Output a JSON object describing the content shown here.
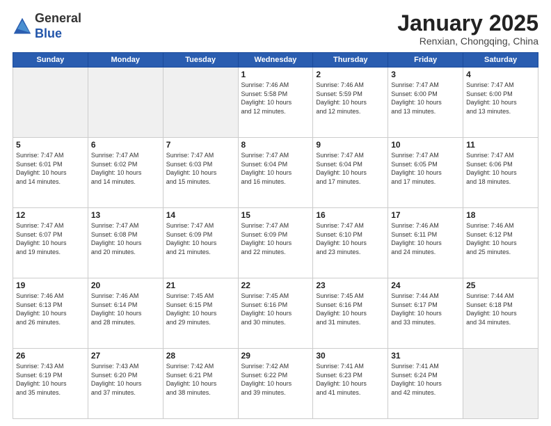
{
  "header": {
    "logo_general": "General",
    "logo_blue": "Blue",
    "month_title": "January 2025",
    "subtitle": "Renxian, Chongqing, China"
  },
  "weekdays": [
    "Sunday",
    "Monday",
    "Tuesday",
    "Wednesday",
    "Thursday",
    "Friday",
    "Saturday"
  ],
  "weeks": [
    [
      {
        "num": "",
        "info": "",
        "empty": true
      },
      {
        "num": "",
        "info": "",
        "empty": true
      },
      {
        "num": "",
        "info": "",
        "empty": true
      },
      {
        "num": "1",
        "info": "Sunrise: 7:46 AM\nSunset: 5:58 PM\nDaylight: 10 hours\nand 12 minutes."
      },
      {
        "num": "2",
        "info": "Sunrise: 7:46 AM\nSunset: 5:59 PM\nDaylight: 10 hours\nand 12 minutes."
      },
      {
        "num": "3",
        "info": "Sunrise: 7:47 AM\nSunset: 6:00 PM\nDaylight: 10 hours\nand 13 minutes."
      },
      {
        "num": "4",
        "info": "Sunrise: 7:47 AM\nSunset: 6:00 PM\nDaylight: 10 hours\nand 13 minutes."
      }
    ],
    [
      {
        "num": "5",
        "info": "Sunrise: 7:47 AM\nSunset: 6:01 PM\nDaylight: 10 hours\nand 14 minutes."
      },
      {
        "num": "6",
        "info": "Sunrise: 7:47 AM\nSunset: 6:02 PM\nDaylight: 10 hours\nand 14 minutes."
      },
      {
        "num": "7",
        "info": "Sunrise: 7:47 AM\nSunset: 6:03 PM\nDaylight: 10 hours\nand 15 minutes."
      },
      {
        "num": "8",
        "info": "Sunrise: 7:47 AM\nSunset: 6:04 PM\nDaylight: 10 hours\nand 16 minutes."
      },
      {
        "num": "9",
        "info": "Sunrise: 7:47 AM\nSunset: 6:04 PM\nDaylight: 10 hours\nand 17 minutes."
      },
      {
        "num": "10",
        "info": "Sunrise: 7:47 AM\nSunset: 6:05 PM\nDaylight: 10 hours\nand 17 minutes."
      },
      {
        "num": "11",
        "info": "Sunrise: 7:47 AM\nSunset: 6:06 PM\nDaylight: 10 hours\nand 18 minutes."
      }
    ],
    [
      {
        "num": "12",
        "info": "Sunrise: 7:47 AM\nSunset: 6:07 PM\nDaylight: 10 hours\nand 19 minutes."
      },
      {
        "num": "13",
        "info": "Sunrise: 7:47 AM\nSunset: 6:08 PM\nDaylight: 10 hours\nand 20 minutes."
      },
      {
        "num": "14",
        "info": "Sunrise: 7:47 AM\nSunset: 6:09 PM\nDaylight: 10 hours\nand 21 minutes."
      },
      {
        "num": "15",
        "info": "Sunrise: 7:47 AM\nSunset: 6:09 PM\nDaylight: 10 hours\nand 22 minutes."
      },
      {
        "num": "16",
        "info": "Sunrise: 7:47 AM\nSunset: 6:10 PM\nDaylight: 10 hours\nand 23 minutes."
      },
      {
        "num": "17",
        "info": "Sunrise: 7:46 AM\nSunset: 6:11 PM\nDaylight: 10 hours\nand 24 minutes."
      },
      {
        "num": "18",
        "info": "Sunrise: 7:46 AM\nSunset: 6:12 PM\nDaylight: 10 hours\nand 25 minutes."
      }
    ],
    [
      {
        "num": "19",
        "info": "Sunrise: 7:46 AM\nSunset: 6:13 PM\nDaylight: 10 hours\nand 26 minutes."
      },
      {
        "num": "20",
        "info": "Sunrise: 7:46 AM\nSunset: 6:14 PM\nDaylight: 10 hours\nand 28 minutes."
      },
      {
        "num": "21",
        "info": "Sunrise: 7:45 AM\nSunset: 6:15 PM\nDaylight: 10 hours\nand 29 minutes."
      },
      {
        "num": "22",
        "info": "Sunrise: 7:45 AM\nSunset: 6:16 PM\nDaylight: 10 hours\nand 30 minutes."
      },
      {
        "num": "23",
        "info": "Sunrise: 7:45 AM\nSunset: 6:16 PM\nDaylight: 10 hours\nand 31 minutes."
      },
      {
        "num": "24",
        "info": "Sunrise: 7:44 AM\nSunset: 6:17 PM\nDaylight: 10 hours\nand 33 minutes."
      },
      {
        "num": "25",
        "info": "Sunrise: 7:44 AM\nSunset: 6:18 PM\nDaylight: 10 hours\nand 34 minutes."
      }
    ],
    [
      {
        "num": "26",
        "info": "Sunrise: 7:43 AM\nSunset: 6:19 PM\nDaylight: 10 hours\nand 35 minutes."
      },
      {
        "num": "27",
        "info": "Sunrise: 7:43 AM\nSunset: 6:20 PM\nDaylight: 10 hours\nand 37 minutes."
      },
      {
        "num": "28",
        "info": "Sunrise: 7:42 AM\nSunset: 6:21 PM\nDaylight: 10 hours\nand 38 minutes."
      },
      {
        "num": "29",
        "info": "Sunrise: 7:42 AM\nSunset: 6:22 PM\nDaylight: 10 hours\nand 39 minutes."
      },
      {
        "num": "30",
        "info": "Sunrise: 7:41 AM\nSunset: 6:23 PM\nDaylight: 10 hours\nand 41 minutes."
      },
      {
        "num": "31",
        "info": "Sunrise: 7:41 AM\nSunset: 6:24 PM\nDaylight: 10 hours\nand 42 minutes."
      },
      {
        "num": "",
        "info": "",
        "empty": true
      }
    ]
  ]
}
